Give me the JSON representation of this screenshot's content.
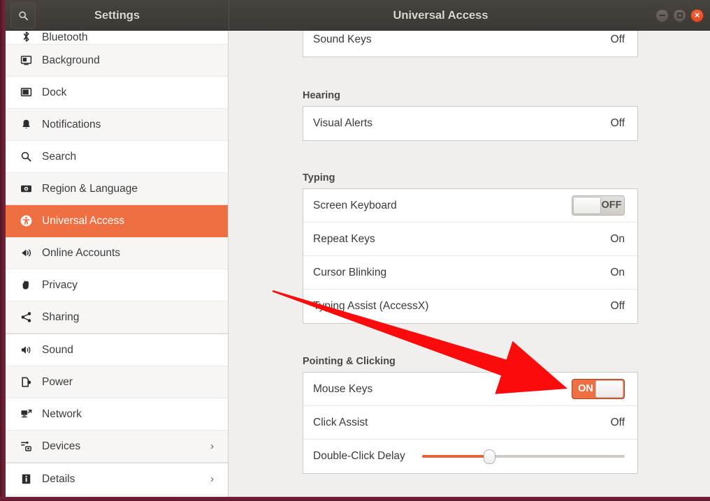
{
  "window": {
    "left_title": "Settings",
    "right_title": "Universal Access",
    "controls": {
      "minimize": "minimize",
      "maximize": "maximize",
      "close": "close"
    },
    "search_icon": "search-icon"
  },
  "sidebar": {
    "items": [
      {
        "label": "Bluetooth",
        "icon": "bluetooth-icon",
        "chevron": "",
        "active": false,
        "partial": true
      },
      {
        "label": "Background",
        "icon": "background-icon",
        "chevron": "",
        "active": false
      },
      {
        "label": "Dock",
        "icon": "dock-icon",
        "chevron": "",
        "active": false
      },
      {
        "label": "Notifications",
        "icon": "bell-icon",
        "chevron": "",
        "active": false
      },
      {
        "label": "Search",
        "icon": "search-icon",
        "chevron": "",
        "active": false
      },
      {
        "label": "Region & Language",
        "icon": "region-language-icon",
        "chevron": "",
        "active": false
      },
      {
        "label": "Universal Access",
        "icon": "universal-access-icon",
        "chevron": "",
        "active": true
      },
      {
        "label": "Online Accounts",
        "icon": "online-accounts-icon",
        "chevron": "",
        "active": false
      },
      {
        "label": "Privacy",
        "icon": "privacy-hand-icon",
        "chevron": "",
        "active": false
      },
      {
        "label": "Sharing",
        "icon": "sharing-icon",
        "chevron": "",
        "active": false
      },
      {
        "label": "Sound",
        "icon": "speaker-icon",
        "chevron": "",
        "active": false
      },
      {
        "label": "Power",
        "icon": "power-icon",
        "chevron": "",
        "active": false
      },
      {
        "label": "Network",
        "icon": "network-icon",
        "chevron": "",
        "active": false
      },
      {
        "label": "Devices",
        "icon": "devices-icon",
        "chevron": "›",
        "active": false
      },
      {
        "label": "Details",
        "icon": "details-info-icon",
        "chevron": "›",
        "active": false
      }
    ]
  },
  "main": {
    "top_row": {
      "label": "Sound Keys",
      "value": "Off"
    },
    "sections": [
      {
        "title": "Hearing",
        "rows": [
          {
            "label": "Visual Alerts",
            "value": "Off",
            "control": "text"
          }
        ]
      },
      {
        "title": "Typing",
        "rows": [
          {
            "label": "Screen Keyboard",
            "value": "OFF",
            "control": "toggle-off"
          },
          {
            "label": "Repeat Keys",
            "value": "On",
            "control": "text"
          },
          {
            "label": "Cursor Blinking",
            "value": "On",
            "control": "text"
          },
          {
            "label": "Typing Assist (AccessX)",
            "value": "Off",
            "control": "text"
          }
        ]
      },
      {
        "title": "Pointing & Clicking",
        "rows": [
          {
            "label": "Mouse Keys",
            "value": "ON",
            "control": "toggle-on"
          },
          {
            "label": "Click Assist",
            "value": "Off",
            "control": "text"
          },
          {
            "label": "Double-Click Delay",
            "value": "",
            "control": "slider",
            "slider_percent": 33
          }
        ]
      }
    ]
  },
  "annotation": {
    "arrow_color": "#fb0b0b",
    "points_to": "Mouse Keys toggle"
  },
  "colors": {
    "accent_orange": "#ef6f43",
    "titlebar": "#423e3a",
    "panel_bg": "#f0efee",
    "frame_maroon": "#6e1f34"
  }
}
